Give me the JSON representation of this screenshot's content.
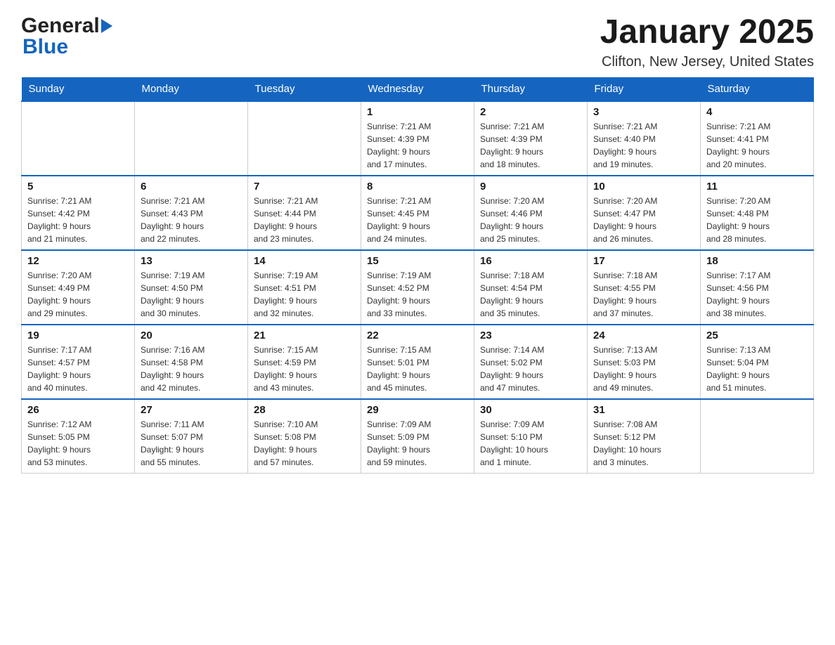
{
  "header": {
    "logo_general": "General",
    "logo_blue": "Blue",
    "month_title": "January 2025",
    "location": "Clifton, New Jersey, United States"
  },
  "days_of_week": [
    "Sunday",
    "Monday",
    "Tuesday",
    "Wednesday",
    "Thursday",
    "Friday",
    "Saturday"
  ],
  "weeks": [
    [
      {
        "day": "",
        "info": ""
      },
      {
        "day": "",
        "info": ""
      },
      {
        "day": "",
        "info": ""
      },
      {
        "day": "1",
        "info": "Sunrise: 7:21 AM\nSunset: 4:39 PM\nDaylight: 9 hours\nand 17 minutes."
      },
      {
        "day": "2",
        "info": "Sunrise: 7:21 AM\nSunset: 4:39 PM\nDaylight: 9 hours\nand 18 minutes."
      },
      {
        "day": "3",
        "info": "Sunrise: 7:21 AM\nSunset: 4:40 PM\nDaylight: 9 hours\nand 19 minutes."
      },
      {
        "day": "4",
        "info": "Sunrise: 7:21 AM\nSunset: 4:41 PM\nDaylight: 9 hours\nand 20 minutes."
      }
    ],
    [
      {
        "day": "5",
        "info": "Sunrise: 7:21 AM\nSunset: 4:42 PM\nDaylight: 9 hours\nand 21 minutes."
      },
      {
        "day": "6",
        "info": "Sunrise: 7:21 AM\nSunset: 4:43 PM\nDaylight: 9 hours\nand 22 minutes."
      },
      {
        "day": "7",
        "info": "Sunrise: 7:21 AM\nSunset: 4:44 PM\nDaylight: 9 hours\nand 23 minutes."
      },
      {
        "day": "8",
        "info": "Sunrise: 7:21 AM\nSunset: 4:45 PM\nDaylight: 9 hours\nand 24 minutes."
      },
      {
        "day": "9",
        "info": "Sunrise: 7:20 AM\nSunset: 4:46 PM\nDaylight: 9 hours\nand 25 minutes."
      },
      {
        "day": "10",
        "info": "Sunrise: 7:20 AM\nSunset: 4:47 PM\nDaylight: 9 hours\nand 26 minutes."
      },
      {
        "day": "11",
        "info": "Sunrise: 7:20 AM\nSunset: 4:48 PM\nDaylight: 9 hours\nand 28 minutes."
      }
    ],
    [
      {
        "day": "12",
        "info": "Sunrise: 7:20 AM\nSunset: 4:49 PM\nDaylight: 9 hours\nand 29 minutes."
      },
      {
        "day": "13",
        "info": "Sunrise: 7:19 AM\nSunset: 4:50 PM\nDaylight: 9 hours\nand 30 minutes."
      },
      {
        "day": "14",
        "info": "Sunrise: 7:19 AM\nSunset: 4:51 PM\nDaylight: 9 hours\nand 32 minutes."
      },
      {
        "day": "15",
        "info": "Sunrise: 7:19 AM\nSunset: 4:52 PM\nDaylight: 9 hours\nand 33 minutes."
      },
      {
        "day": "16",
        "info": "Sunrise: 7:18 AM\nSunset: 4:54 PM\nDaylight: 9 hours\nand 35 minutes."
      },
      {
        "day": "17",
        "info": "Sunrise: 7:18 AM\nSunset: 4:55 PM\nDaylight: 9 hours\nand 37 minutes."
      },
      {
        "day": "18",
        "info": "Sunrise: 7:17 AM\nSunset: 4:56 PM\nDaylight: 9 hours\nand 38 minutes."
      }
    ],
    [
      {
        "day": "19",
        "info": "Sunrise: 7:17 AM\nSunset: 4:57 PM\nDaylight: 9 hours\nand 40 minutes."
      },
      {
        "day": "20",
        "info": "Sunrise: 7:16 AM\nSunset: 4:58 PM\nDaylight: 9 hours\nand 42 minutes."
      },
      {
        "day": "21",
        "info": "Sunrise: 7:15 AM\nSunset: 4:59 PM\nDaylight: 9 hours\nand 43 minutes."
      },
      {
        "day": "22",
        "info": "Sunrise: 7:15 AM\nSunset: 5:01 PM\nDaylight: 9 hours\nand 45 minutes."
      },
      {
        "day": "23",
        "info": "Sunrise: 7:14 AM\nSunset: 5:02 PM\nDaylight: 9 hours\nand 47 minutes."
      },
      {
        "day": "24",
        "info": "Sunrise: 7:13 AM\nSunset: 5:03 PM\nDaylight: 9 hours\nand 49 minutes."
      },
      {
        "day": "25",
        "info": "Sunrise: 7:13 AM\nSunset: 5:04 PM\nDaylight: 9 hours\nand 51 minutes."
      }
    ],
    [
      {
        "day": "26",
        "info": "Sunrise: 7:12 AM\nSunset: 5:05 PM\nDaylight: 9 hours\nand 53 minutes."
      },
      {
        "day": "27",
        "info": "Sunrise: 7:11 AM\nSunset: 5:07 PM\nDaylight: 9 hours\nand 55 minutes."
      },
      {
        "day": "28",
        "info": "Sunrise: 7:10 AM\nSunset: 5:08 PM\nDaylight: 9 hours\nand 57 minutes."
      },
      {
        "day": "29",
        "info": "Sunrise: 7:09 AM\nSunset: 5:09 PM\nDaylight: 9 hours\nand 59 minutes."
      },
      {
        "day": "30",
        "info": "Sunrise: 7:09 AM\nSunset: 5:10 PM\nDaylight: 10 hours\nand 1 minute."
      },
      {
        "day": "31",
        "info": "Sunrise: 7:08 AM\nSunset: 5:12 PM\nDaylight: 10 hours\nand 3 minutes."
      },
      {
        "day": "",
        "info": ""
      }
    ]
  ]
}
